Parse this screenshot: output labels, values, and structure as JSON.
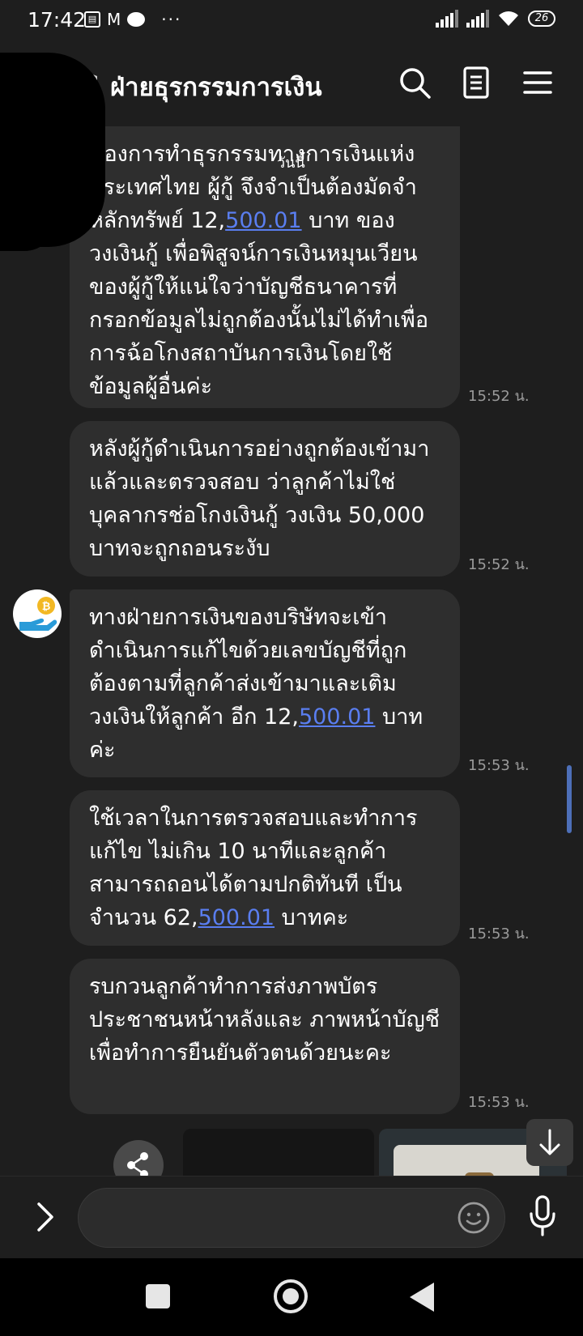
{
  "status_bar": {
    "time": "17:42",
    "battery": "26",
    "left_icons": [
      "gallery-icon",
      "gmail-icon",
      "line-icon"
    ],
    "more": "···"
  },
  "header": {
    "title": "ฝ่ายธุรกรรมการเงิน",
    "icons": [
      "shield-icon",
      "search-icon",
      "notes-icon",
      "menu-icon"
    ]
  },
  "floating_note": "วันนี้",
  "messages": [
    {
      "text_before": "ของการทำธุรกรรมทางการเงินแห่งประเทศไทย ผู้กู้ จึงจำเป็นต้องมัดจำหลักทรัพย์ 12,",
      "link": "500.01",
      "text_after": " บาท ของวงเงินกู้  เพื่อพิสูจน์การเงินหมุนเวียนของผู้กู้ให้แน่ใจว่าบัญชีธนาคารที่กรอกข้อมูลไม่ถูกต้องนั้นไม่ได้ทำเพื่อการฉ้อโกงสถาบันการเงินโดยใช้ข้อมูลผู้อื่นค่ะ",
      "time": "15:52 น."
    },
    {
      "text": "หลังผู้กู้ดำเนินการอย่างถูกต้องเข้ามาแล้วและตรวจสอบ   ว่าลูกค้าไม่ใช่บุคลากรช่อโกงเงินกู้ วงเงิน 50,000 บาทจะถูกถอนระงับ",
      "time": "15:52 น."
    },
    {
      "text_before": "ทางฝ่ายการเงินของบริษัทจะเข้าดำเนินการแก้ไขด้วยเลขบัญชีที่ถูกต้องตามที่ลูกค้าส่งเข้ามาและเติมวงเงินให้ลูกค้า อีก 12,",
      "link": "500.01",
      "text_after": " บาท ค่ะ",
      "time": "15:53 น."
    },
    {
      "text_before": "ใช้เวลาในการตรวจสอบและทำการแก้ไข ไม่เกิน 10 นาทีและลูกค้าสามารถถอนได้ตามปกติทันที เป็นจำนวน  62,",
      "link": "500.01",
      "text_after": "  บาทคะ",
      "time": "15:53 น."
    },
    {
      "text": "รบกวนลูกค้าทำการส่งภาพบัตรประชาชนหน้าหลังและ  ภาพหน้าบัญชีเพื่อทำการยืนยันตัวตนด้วยนะคะ",
      "time": "15:53 น."
    }
  ],
  "sender_avatar_icon": "coin-hand-icon",
  "input": {
    "placeholder": ""
  },
  "colors": {
    "background": "#1e1e1e",
    "bubble": "#2e2e2e",
    "link": "#5a7ef0",
    "time": "#9a9a9a"
  }
}
